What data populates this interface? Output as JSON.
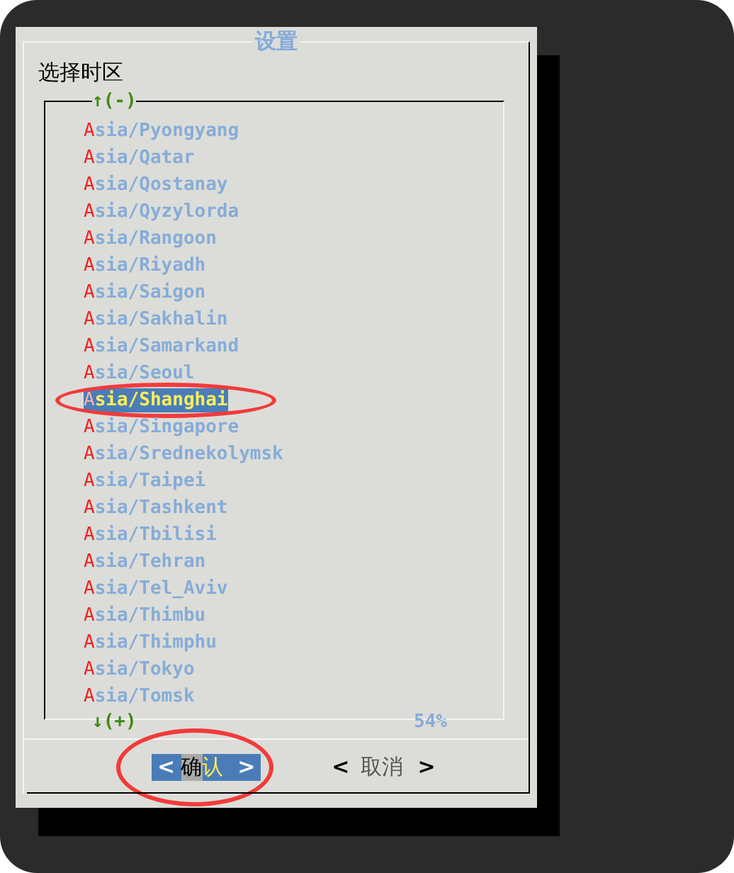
{
  "dialog": {
    "title": "设置",
    "prompt": "选择时区",
    "list": {
      "scroll_up": "↑(-)",
      "scroll_down": "↓(+)",
      "percent": "54%",
      "items": [
        {
          "label": "Asia/Pyongyang",
          "selected": false,
          "circled": false
        },
        {
          "label": "Asia/Qatar",
          "selected": false,
          "circled": false
        },
        {
          "label": "Asia/Qostanay",
          "selected": false,
          "circled": false
        },
        {
          "label": "Asia/Qyzylorda",
          "selected": false,
          "circled": false
        },
        {
          "label": "Asia/Rangoon",
          "selected": false,
          "circled": false
        },
        {
          "label": "Asia/Riyadh",
          "selected": false,
          "circled": false
        },
        {
          "label": "Asia/Saigon",
          "selected": false,
          "circled": false
        },
        {
          "label": "Asia/Sakhalin",
          "selected": false,
          "circled": false
        },
        {
          "label": "Asia/Samarkand",
          "selected": false,
          "circled": false
        },
        {
          "label": "Asia/Seoul",
          "selected": false,
          "circled": false
        },
        {
          "label": "Asia/Shanghai",
          "selected": true,
          "circled": true
        },
        {
          "label": "Asia/Singapore",
          "selected": false,
          "circled": false
        },
        {
          "label": "Asia/Srednekolymsk",
          "selected": false,
          "circled": false
        },
        {
          "label": "Asia/Taipei",
          "selected": false,
          "circled": false
        },
        {
          "label": "Asia/Tashkent",
          "selected": false,
          "circled": false
        },
        {
          "label": "Asia/Tbilisi",
          "selected": false,
          "circled": false
        },
        {
          "label": "Asia/Tehran",
          "selected": false,
          "circled": false
        },
        {
          "label": "Asia/Tel_Aviv",
          "selected": false,
          "circled": false
        },
        {
          "label": "Asia/Thimbu",
          "selected": false,
          "circled": false
        },
        {
          "label": "Asia/Thimphu",
          "selected": false,
          "circled": false
        },
        {
          "label": "Asia/Tokyo",
          "selected": false,
          "circled": false
        },
        {
          "label": "Asia/Tomsk",
          "selected": false,
          "circled": false
        }
      ]
    },
    "buttons": [
      {
        "left": "<",
        "label": "确认",
        "right": ">",
        "selected": true,
        "circled": true
      },
      {
        "left": "<",
        "label": "取消",
        "right": ">",
        "selected": false,
        "circled": false
      }
    ]
  }
}
